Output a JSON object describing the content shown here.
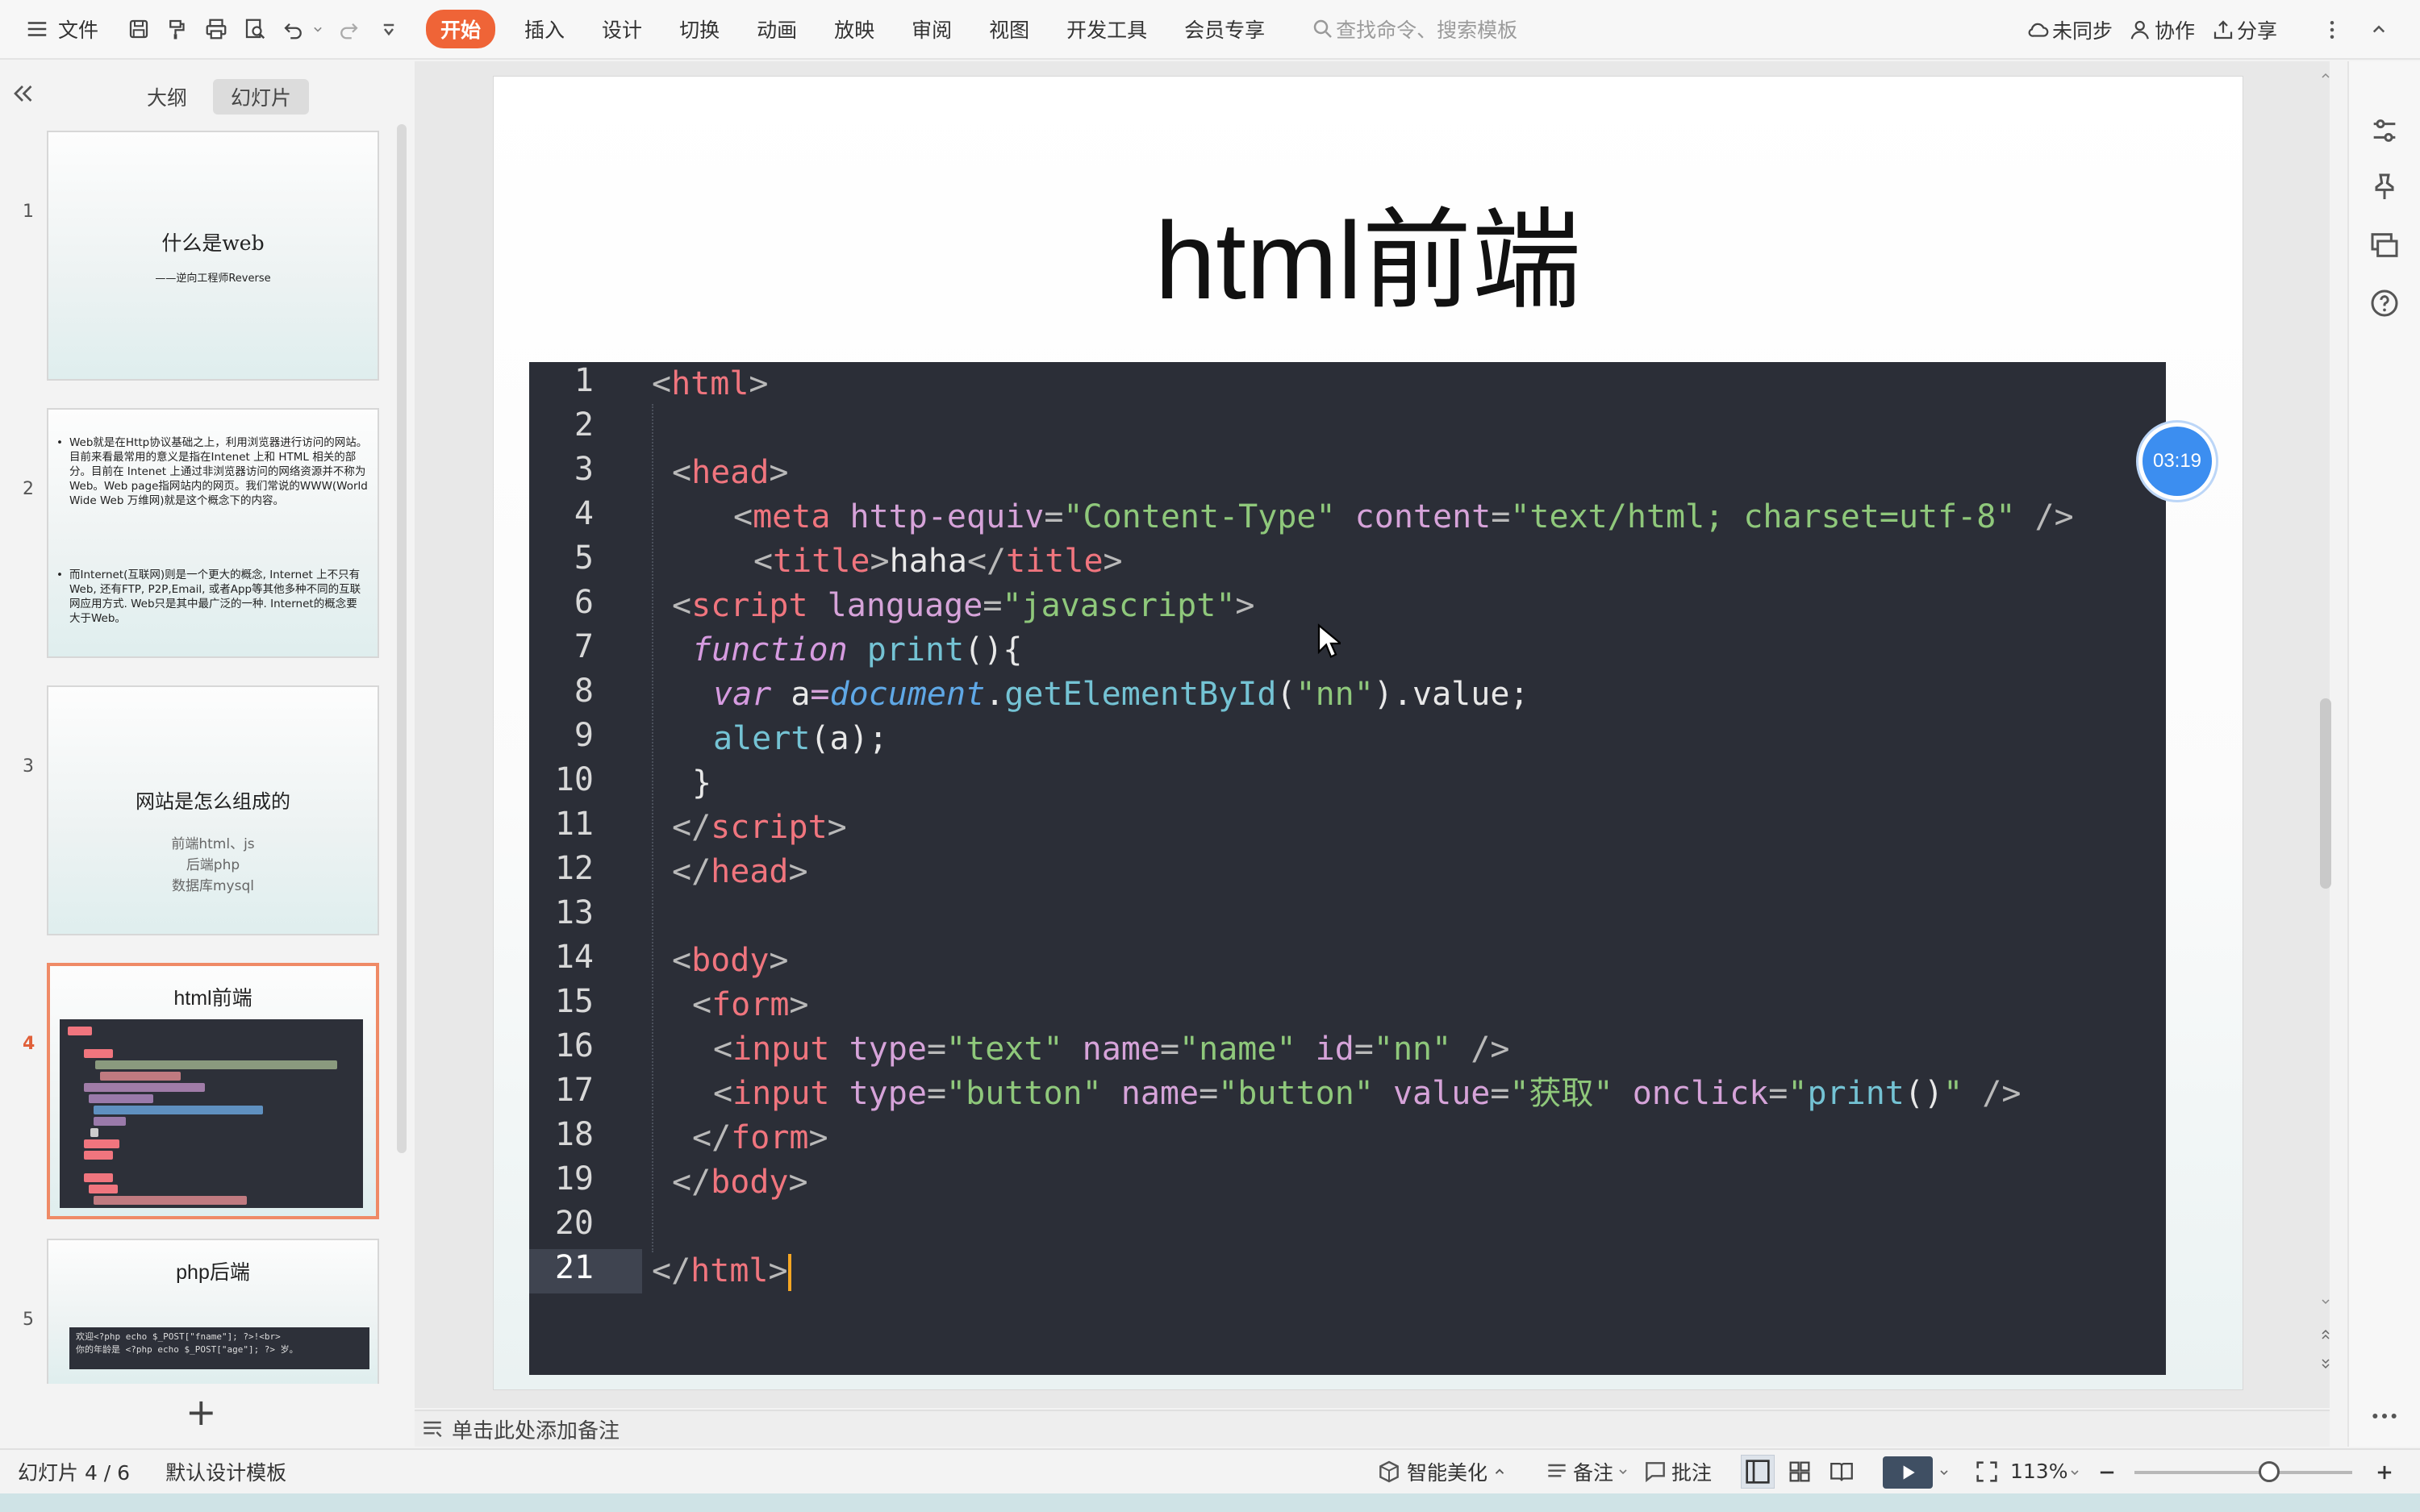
{
  "toolbar": {
    "file_label": "文件",
    "menu_tabs": [
      "开始",
      "插入",
      "设计",
      "切换",
      "动画",
      "放映",
      "审阅",
      "视图",
      "开发工具",
      "会员专享"
    ],
    "search_placeholder": "查找命令、搜索模板",
    "sync_label": "未同步",
    "collab_label": "协作",
    "share_label": "分享"
  },
  "left_panel": {
    "tabs": [
      "大纲",
      "幻灯片"
    ],
    "active_tab": "幻灯片",
    "thumbnails": [
      {
        "num": "1",
        "title": "什么是web",
        "subtitle": "——逆向工程师Reverse"
      },
      {
        "num": "2",
        "bullets": [
          "Web就是在Http协议基础之上，利用浏览器进行访问的网站。目前来看最常用的意义是指在Intenet 上和 HTML 相关的部分。目前在 Intenet 上通过非浏览器访问的网络资源并不称为 Web。Web page指网站内的网页。我们常说的WWW(World Wide Web 万维网)就是这个概念下的内容。",
          "而Internet(互联网)则是一个更大的概念, Internet 上不只有Web, 还有FTP, P2P,Email, 或者App等其他多种不同的互联网应用方式. Web只是其中最广泛的一种. Internet的概念要大于Web。"
        ]
      },
      {
        "num": "3",
        "title": "网站是怎么组成的",
        "lines": [
          "前端html、js",
          "后端php",
          "数据库mysql"
        ]
      },
      {
        "num": "4",
        "title": "html前端"
      },
      {
        "num": "5",
        "title": "php后端",
        "code": [
          "欢迎<?php echo $_POST[\"fname\"]; ?>!<br>",
          "你的年龄是 <?php echo $_POST[\"age\"]; ?>  岁。"
        ]
      }
    ],
    "active_slide": 4
  },
  "slide": {
    "title": "html前端",
    "timer": "03:19",
    "line_numbers": [
      "1",
      "2",
      "3",
      "4",
      "5",
      "6",
      "7",
      "8",
      "9",
      "10",
      "11",
      "12",
      "13",
      "14",
      "15",
      "16",
      "17",
      "18",
      "19",
      "20",
      "21"
    ],
    "active_line": 21,
    "code": {
      "l1_lt": "<",
      "l1_tag": "html",
      "l1_gt": ">",
      "l3_lt": "<",
      "l3_tag": "head",
      "l3_gt": ">",
      "l4_lt": "<",
      "l4_tag": "meta",
      "l4_attr1": " http-equiv",
      "l4_eq1": "=",
      "l4_val1": "\"Content-Type\"",
      "l4_attr2": " content",
      "l4_eq2": "=",
      "l4_val2": "\"text/html; charset=utf-8\"",
      "l4_end": " />",
      "l5_lt": "<",
      "l5_tag": "title",
      "l5_gt": ">",
      "l5_text": "haha",
      "l5_close_lt": "</",
      "l5_close_tag": "title",
      "l5_close_gt": ">",
      "l6_lt": "<",
      "l6_tag": "script",
      "l6_attr": " language",
      "l6_eq": "=",
      "l6_val": "\"javascript\"",
      "l6_gt": ">",
      "l7_kw": "function",
      "l7_fn": " print",
      "l7_rest": "(){",
      "l8_kw": "var",
      "l8_var": " a",
      "l8_eq": "=",
      "l8_obj": "document",
      "l8_dot": ".",
      "l8_fn": "getElementById",
      "l8_p1": "(",
      "l8_str": "\"nn\"",
      "l8_p2": ").value;",
      "l9_fn": "alert",
      "l9_rest": "(a);",
      "l10": "}",
      "l11_lt": "</",
      "l11_tag": "script",
      "l11_gt": ">",
      "l12_lt": "</",
      "l12_tag": "head",
      "l12_gt": ">",
      "l14_lt": "<",
      "l14_tag": "body",
      "l14_gt": ">",
      "l15_lt": "<",
      "l15_tag": "form",
      "l15_gt": ">",
      "l16_lt": "<",
      "l16_tag": "input",
      "l16_a1": " type",
      "l16_e1": "=",
      "l16_v1": "\"text\"",
      "l16_a2": " name",
      "l16_e2": "=",
      "l16_v2": "\"name\"",
      "l16_a3": " id",
      "l16_e3": "=",
      "l16_v3": "\"nn\"",
      "l16_end": " />",
      "l17_lt": "<",
      "l17_tag": "input",
      "l17_a1": " type",
      "l17_e1": "=",
      "l17_v1": "\"button\"",
      "l17_a2": " name",
      "l17_e2": "=",
      "l17_v2": "\"button\"",
      "l17_a3": " value",
      "l17_e3": "=",
      "l17_v3": "\"获取\"",
      "l17_a4": " onclick",
      "l17_e4": "=",
      "l17_q1": "\"",
      "l17_fn": "print",
      "l17_paren": "()",
      "l17_q2": "\"",
      "l17_end": " />",
      "l18_lt": "</",
      "l18_tag": "form",
      "l18_gt": ">",
      "l19_lt": "</",
      "l19_tag": "body",
      "l19_gt": ">",
      "l21_lt": "</",
      "l21_tag": "html",
      "l21_gt": ">"
    }
  },
  "notes_placeholder": "单击此处添加备注",
  "status_bar": {
    "slide_counter": "幻灯片 4 / 6",
    "template": "默认设计模板",
    "beautify": "智能美化",
    "notes": "备注",
    "comments": "批注",
    "zoom": "113%",
    "zoom_level": 0.62
  },
  "colors": {
    "accent": "#ef6437",
    "code_bg": "#2b2e37",
    "timer": "#3c8ef0"
  }
}
